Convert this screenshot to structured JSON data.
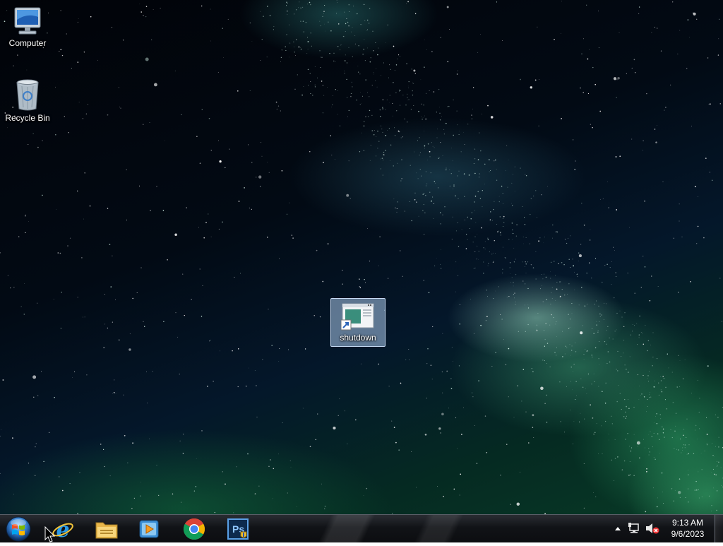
{
  "desktop": {
    "icons": [
      {
        "label": "Computer"
      },
      {
        "label": "Recycle Bin"
      },
      {
        "label": "shutdown"
      }
    ]
  },
  "taskbar": {
    "start": {
      "icon": "windows-orb-icon"
    },
    "pinned": [
      {
        "icon": "internet-explorer-icon"
      },
      {
        "icon": "file-explorer-icon"
      },
      {
        "icon": "media-player-icon"
      },
      {
        "icon": "chrome-icon"
      },
      {
        "icon": "photoshop-icon"
      }
    ],
    "tray": {
      "icons": [
        "show-hidden-icons-icon",
        "network-icon",
        "volume-muted-icon"
      ],
      "time": "9:13 AM",
      "date": "9/6/2023"
    }
  },
  "colors": {
    "selection": "#aac8eb",
    "taskbar": "#111317"
  }
}
